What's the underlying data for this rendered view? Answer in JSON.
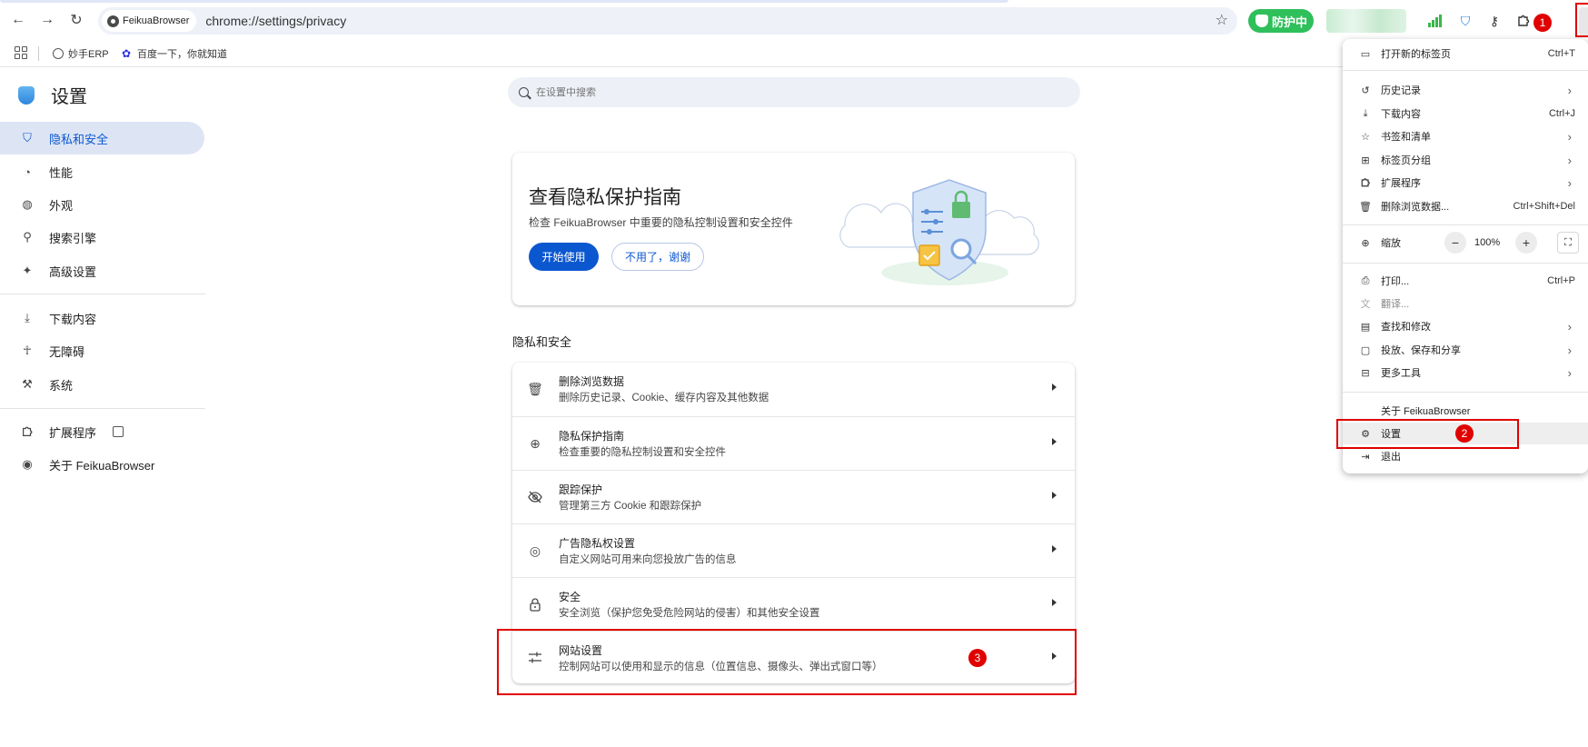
{
  "address_bar": {
    "origin_chip": "FeikuaBrowser",
    "url": "chrome://settings/privacy"
  },
  "extensions": {
    "protect_label": "防护中"
  },
  "bookmarks": [
    {
      "label": "妙手ERP",
      "icon": "globe-icon"
    },
    {
      "label": "百度一下，你就知道",
      "icon": "baidu-paw-icon"
    }
  ],
  "sidebar": {
    "title": "设置",
    "items": [
      {
        "label": "隐私和安全",
        "icon": "shield-icon",
        "active": true
      },
      {
        "label": "性能",
        "icon": "speedometer-icon"
      },
      {
        "label": "外观",
        "icon": "palette-icon"
      },
      {
        "label": "搜索引擎",
        "icon": "search-icon"
      },
      {
        "label": "高级设置",
        "icon": "sparkle-icon"
      },
      {
        "label": "下载内容",
        "icon": "download-icon"
      },
      {
        "label": "无障碍",
        "icon": "accessibility-icon"
      },
      {
        "label": "系统",
        "icon": "wrench-icon"
      },
      {
        "label": "扩展程序",
        "icon": "puzzle-icon"
      },
      {
        "label": "关于 FeikuaBrowser",
        "icon": "browser-logo-icon"
      }
    ]
  },
  "search": {
    "placeholder": "在设置中搜索"
  },
  "guide_card": {
    "title": "查看隐私保护指南",
    "description": "检查 FeikuaBrowser 中重要的隐私控制设置和安全控件",
    "primary_label": "开始使用",
    "secondary_label": "不用了，谢谢"
  },
  "privacy_section": {
    "heading": "隐私和安全",
    "rows": [
      {
        "title": "删除浏览数据",
        "subtitle": "删除历史记录、Cookie、缓存内容及其他数据",
        "icon": "trash-icon"
      },
      {
        "title": "隐私保护指南",
        "subtitle": "检查重要的隐私控制设置和安全控件",
        "icon": "compass-icon"
      },
      {
        "title": "跟踪保护",
        "subtitle": "管理第三方 Cookie 和跟踪保护",
        "icon": "eye-off-icon"
      },
      {
        "title": "广告隐私权设置",
        "subtitle": "自定义网站可用来向您投放广告的信息",
        "icon": "ads-target-icon"
      },
      {
        "title": "安全",
        "subtitle": "安全浏览（保护您免受危险网站的侵害）和其他安全设置",
        "icon": "lock-icon"
      },
      {
        "title": "网站设置",
        "subtitle": "控制网站可以使用和显示的信息（位置信息、摄像头、弹出式窗口等）",
        "icon": "sliders-icon"
      }
    ]
  },
  "menu": {
    "new_tab": {
      "label": "打开新的标签页",
      "shortcut": "Ctrl+T"
    },
    "history": {
      "label": "历史记录"
    },
    "downloads": {
      "label": "下载内容",
      "shortcut": "Ctrl+J"
    },
    "bookmarks": {
      "label": "书签和清单"
    },
    "tab_groups": {
      "label": "标签页分组"
    },
    "extensions": {
      "label": "扩展程序"
    },
    "clear_data": {
      "label": "删除浏览数据...",
      "shortcut": "Ctrl+Shift+Del"
    },
    "zoom": {
      "label": "缩放",
      "minus": "−",
      "value": "100%",
      "plus": "+"
    },
    "print": {
      "label": "打印...",
      "shortcut": "Ctrl+P"
    },
    "translate": {
      "label": "翻译..."
    },
    "find": {
      "label": "查找和修改"
    },
    "cast": {
      "label": "投放、保存和分享"
    },
    "more_tools": {
      "label": "更多工具"
    },
    "about": {
      "label": "关于 FeikuaBrowser"
    },
    "settings": {
      "label": "设置"
    },
    "exit": {
      "label": "退出"
    }
  },
  "annotations": {
    "step1": "1",
    "step2": "2",
    "step3": "3"
  },
  "colors": {
    "accent": "#0b57d0",
    "active_bg": "#dde5f5",
    "protect_green": "#2fbf5b",
    "annotation_red": "#e00000"
  }
}
